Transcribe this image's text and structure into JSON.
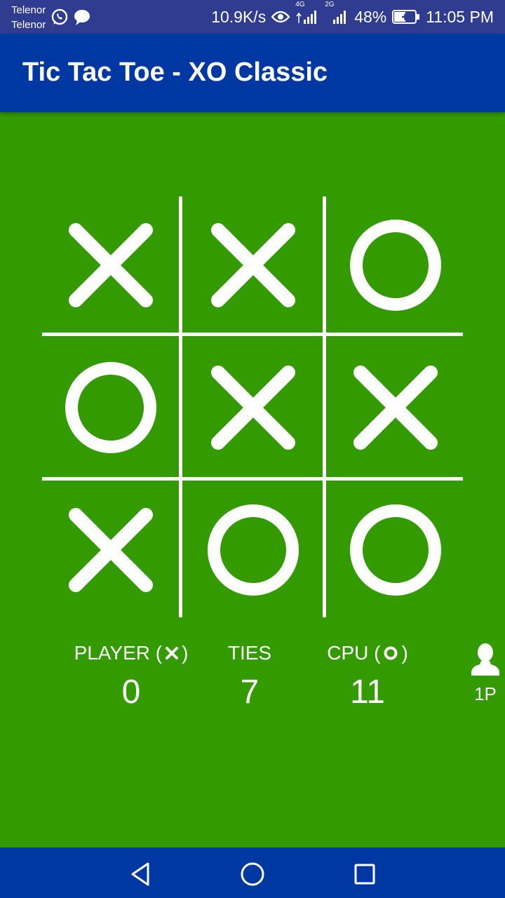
{
  "status_bar": {
    "carrier_1": "Telenor",
    "carrier_2": "Telenor",
    "speed": "10.9K/s",
    "net_4g": "4G",
    "net_2g": "2G",
    "battery": "48%",
    "time": "11:05 PM",
    "left_icons": [
      "whatsapp-icon",
      "message-icon"
    ],
    "right_icons": [
      "eye-icon",
      "signal-icon",
      "signal-icon",
      "battery-charging-icon"
    ]
  },
  "app_bar": {
    "title": "Tic Tac Toe - XO Classic"
  },
  "board": {
    "cells": [
      "X",
      "X",
      "O",
      "O",
      "X",
      "X",
      "X",
      "O",
      "O"
    ]
  },
  "score": {
    "player_label": "PLAYER (",
    "player_label_end": ")",
    "player_value": "0",
    "ties_label": "TIES",
    "ties_value": "7",
    "cpu_label": "CPU (",
    "cpu_label_end": ")",
    "cpu_value": "11"
  },
  "mode": {
    "label": "1P",
    "icon": "person-icon"
  },
  "nav": {
    "icons": [
      "back-icon",
      "home-icon",
      "recents-icon"
    ]
  },
  "colors": {
    "background": "#339a00",
    "app_bar": "#0038a3",
    "status_bar": "#2f3c8f",
    "marks": "#ffffff"
  }
}
